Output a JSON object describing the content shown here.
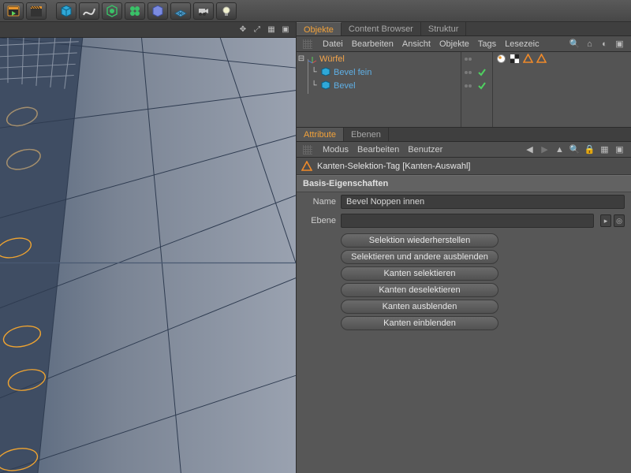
{
  "toolbar_icons": [
    "record-frame",
    "clapper",
    "cube",
    "spline",
    "sds",
    "array",
    "boole",
    "floor",
    "camera",
    "light"
  ],
  "viewport_header_icons": [
    "move-arrows",
    "expand",
    "grid",
    "maximize"
  ],
  "panels": {
    "object_tabs": [
      {
        "label": "Objekte",
        "active": true
      },
      {
        "label": "Content Browser",
        "active": false
      },
      {
        "label": "Struktur",
        "active": false
      }
    ],
    "object_menu": [
      "Datei",
      "Bearbeiten",
      "Ansicht",
      "Objekte",
      "Tags",
      "Lesezeic"
    ],
    "object_menu_tools": [
      "search",
      "home",
      "eye",
      "maximize"
    ]
  },
  "tree": {
    "root": {
      "label": "Würfel"
    },
    "children": [
      {
        "label": "Bevel fein"
      },
      {
        "label": "Bevel"
      }
    ]
  },
  "attribute_tabs": [
    {
      "label": "Attribute",
      "active": true
    },
    {
      "label": "Ebenen",
      "active": false
    }
  ],
  "attribute_menu": [
    "Modus",
    "Bearbeiten",
    "Benutzer"
  ],
  "attribute_menu_tools": [
    "back",
    "fwd",
    "up",
    "search",
    "lock",
    "grid",
    "maximize"
  ],
  "attr": {
    "selection_title": "Kanten-Selektion-Tag [Kanten-Auswahl]",
    "section": "Basis-Eigenschaften",
    "name_label": "Name",
    "name_value": "Bevel Noppen innen",
    "layer_label": "Ebene",
    "layer_value": "",
    "buttons": [
      "Selektion wiederherstellen",
      "Selektieren und andere ausblenden",
      "Kanten selektieren",
      "Kanten deselektieren",
      "Kanten ausblenden",
      "Kanten einblenden"
    ]
  }
}
